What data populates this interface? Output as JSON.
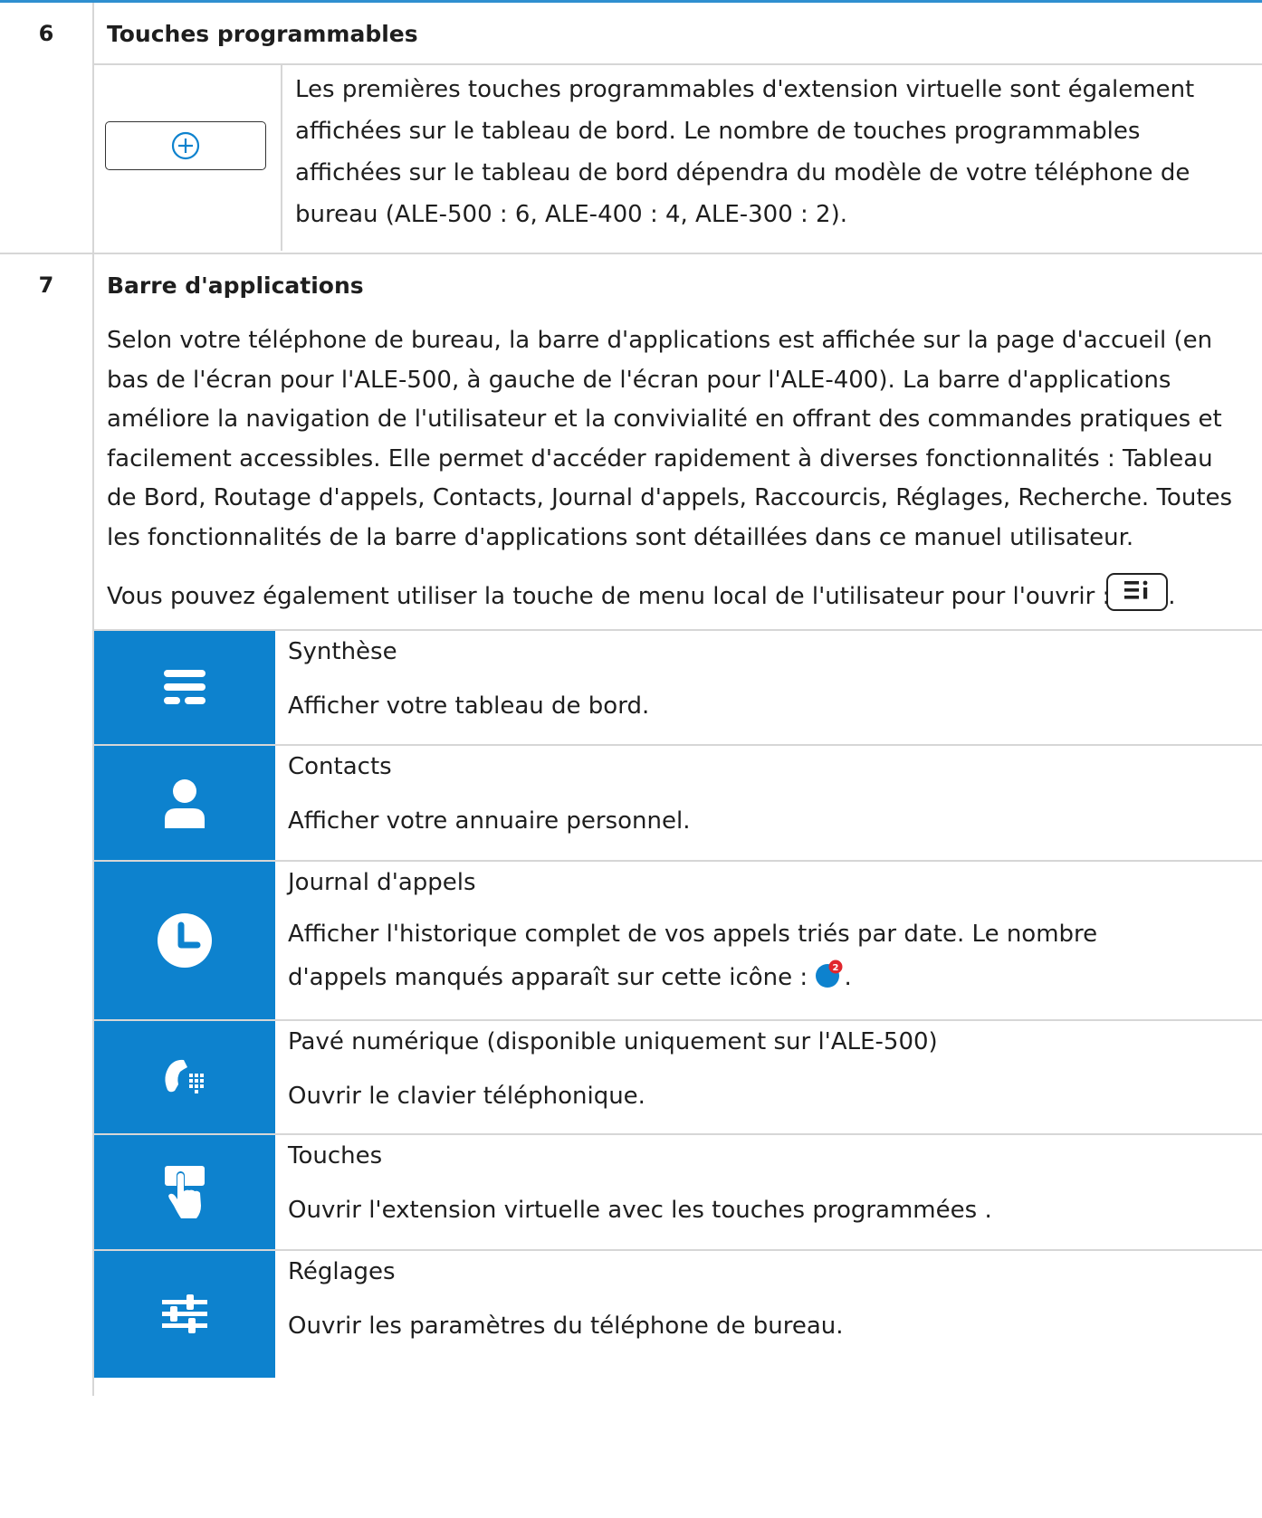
{
  "colors": {
    "accent": "#0d82ce",
    "top_rule": "#2f8fd0",
    "badge_red": "#e0262d"
  },
  "row6": {
    "number": "6",
    "title": "Touches programmables",
    "key_icon": "circle-plus-icon",
    "description": "Les premières touches programmables d'extension virtuelle sont également affichées sur le tableau de bord. Le nombre de touches programmables affichées sur le tableau de bord dépendra du modèle de votre téléphone de bureau (ALE-500 : 6, ALE-400 : 4, ALE-300 : 2)."
  },
  "row7": {
    "number": "7",
    "title": "Barre d'applications",
    "paragraph": "Selon votre téléphone de bureau, la barre d'applications est affichée sur la page d'accueil (en bas de l'écran pour l'ALE-500, à gauche de l'écran pour l'ALE-400). La barre d'applications améliore la navigation de l'utilisateur et la convivialité en offrant des commandes pratiques et facilement accessibles. Elle permet d'accéder rapidement à diverses fonctionnalités : Tableau de Bord, Routage d'appels, Contacts, Journal d'appels, Raccourcis, Réglages, Recherche. Toutes les fonctionnalités de la barre d'applications sont détaillées dans ce manuel utilisateur.",
    "menu_key_text": "Vous pouvez également utiliser la touche de menu local de l'utilisateur pour l'ouvrir :",
    "menu_key_end": ".",
    "menu_key_icon": "local-menu-key-icon",
    "apps": [
      {
        "icon": "dashboard-icon",
        "name": "Synthèse",
        "desc": "Afficher votre tableau de bord."
      },
      {
        "icon": "contact-person-icon",
        "name": "Contacts",
        "desc": "Afficher votre annuaire personnel."
      },
      {
        "icon": "clock-icon",
        "name": "Journal d'appels",
        "desc": "Afficher l'historique complet de vos appels triés par date. Le nombre d'appels manqués apparaît sur cette icône :",
        "desc_end": ".",
        "badge_count": "2"
      },
      {
        "icon": "phone-keypad-icon",
        "name": "Pavé numérique (disponible uniquement sur l'ALE-500)",
        "desc": "Ouvrir le clavier téléphonique."
      },
      {
        "icon": "touch-key-icon",
        "name": "Touches",
        "desc": "Ouvrir l'extension virtuelle avec les touches programmées ."
      },
      {
        "icon": "settings-sliders-icon",
        "name": "Réglages",
        "desc": "Ouvrir les paramètres du téléphone de bureau."
      }
    ]
  }
}
